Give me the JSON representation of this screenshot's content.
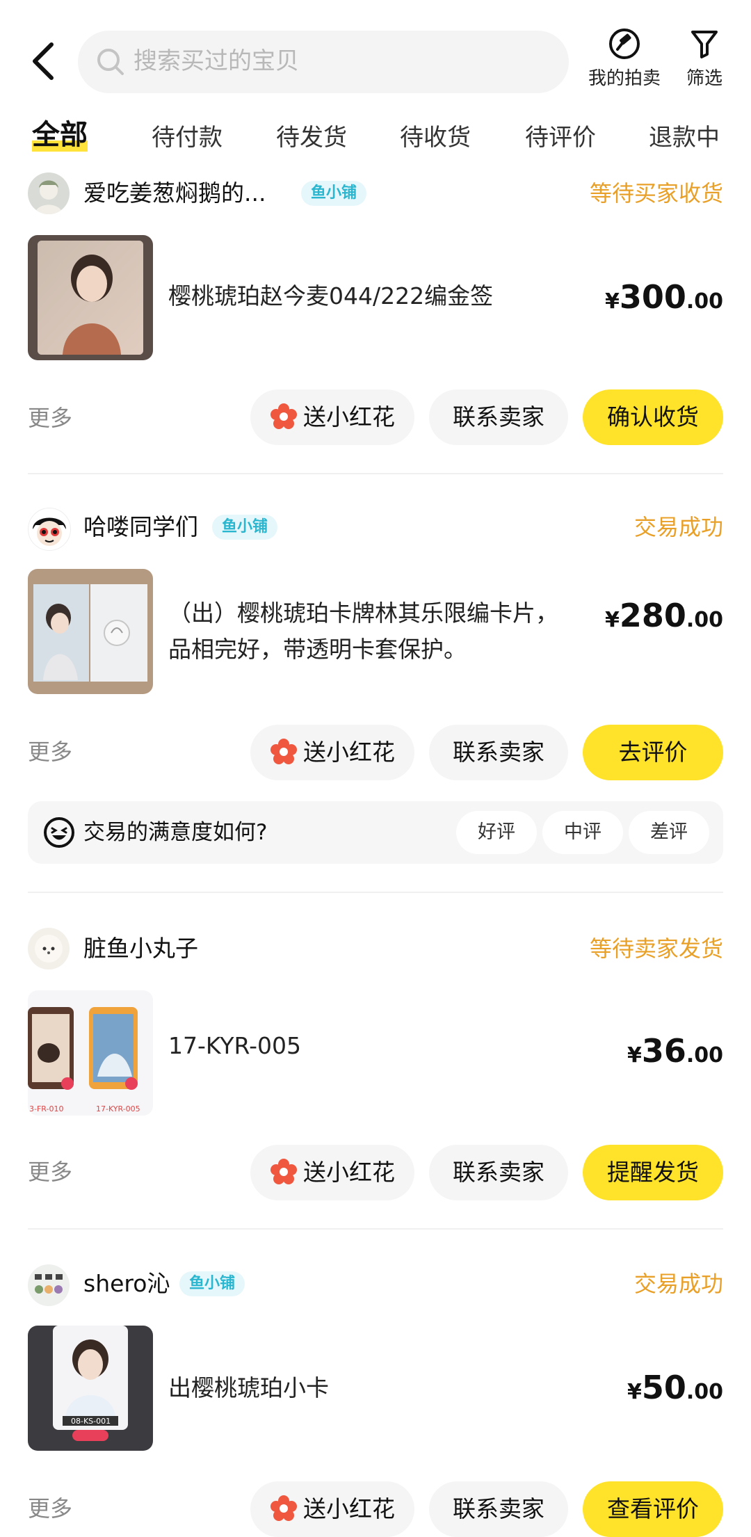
{
  "header": {
    "search_placeholder": "搜索买过的宝贝",
    "auction_label": "我的拍卖",
    "filter_label": "筛选"
  },
  "tabs": [
    "全部",
    "待付款",
    "待发货",
    "待收货",
    "待评价",
    "退款中"
  ],
  "badge_label": "鱼小铺",
  "orders": [
    {
      "seller": "爱吃姜葱焖鹅的...",
      "has_badge": true,
      "status": "等待买家收货",
      "title": "樱桃琥珀赵今麦044/222编金签",
      "price_symbol": "¥",
      "price_int": "300",
      "price_dec": ".00",
      "more": "更多",
      "btn1": "送小红花",
      "btn2": "联系卖家",
      "btn3": "确认收货"
    },
    {
      "seller": "哈喽同学们",
      "has_badge": true,
      "status": "交易成功",
      "title": "（出）樱桃琥珀卡牌林其乐限编卡片，品相完好，带透明卡套保护。",
      "price_symbol": "¥",
      "price_int": "280",
      "price_dec": ".00",
      "more": "更多",
      "btn1": "送小红花",
      "btn2": "联系卖家",
      "btn3": "去评价"
    },
    {
      "seller": "脏鱼小丸子",
      "has_badge": false,
      "status": "等待卖家发货",
      "title": "17-KYR-005",
      "price_symbol": "¥",
      "price_int": "36",
      "price_dec": ".00",
      "more": "更多",
      "btn1": "送小红花",
      "btn2": "联系卖家",
      "btn3": "提醒发货"
    },
    {
      "seller": "shero沁",
      "has_badge": true,
      "status": "交易成功",
      "title": "出樱桃琥珀小卡",
      "price_symbol": "¥",
      "price_int": "50",
      "price_dec": ".00",
      "more": "更多",
      "btn1": "送小红花",
      "btn2": "联系卖家",
      "btn3": "查看评价"
    }
  ],
  "rating": {
    "question": "交易的满意度如何?",
    "good": "好评",
    "neutral": "中评",
    "bad": "差评"
  },
  "colors": {
    "accent_yellow": "#ffe22a",
    "status_orange": "#e9a028",
    "badge_blue": "#2bb6cf"
  },
  "thumbs": {
    "order0": "card-3-fr-010",
    "order2_captions": [
      "3-FR-010",
      "17-KYR-005"
    ],
    "order3_caption": "08-KS-001"
  }
}
